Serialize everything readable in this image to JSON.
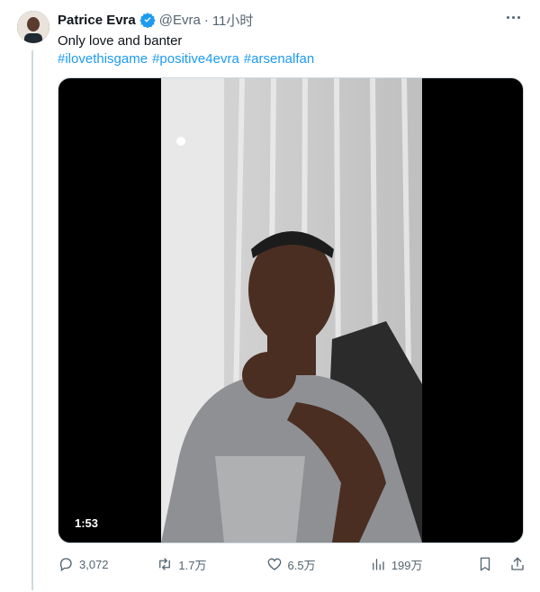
{
  "tweet": {
    "author_name": "Patrice Evra",
    "handle": "@Evra",
    "separator": "·",
    "time": "11小时",
    "text": "Only love and banter",
    "hashtags": [
      "#ilovethisgame",
      "#positive4evra",
      "#arsenalfan"
    ]
  },
  "media": {
    "duration": "1:53"
  },
  "actions": {
    "replies": "3,072",
    "retweets": "1.7万",
    "likes": "6.5万",
    "views": "199万"
  },
  "icons": {
    "verified": "verified-badge-icon",
    "more": "more-icon",
    "reply": "reply-icon",
    "retweet": "retweet-icon",
    "like": "heart-icon",
    "views": "views-icon",
    "bookmark": "bookmark-icon",
    "share": "share-icon"
  },
  "colors": {
    "accent": "#1d9bf0",
    "text": "#0f1419",
    "muted": "#536471"
  }
}
